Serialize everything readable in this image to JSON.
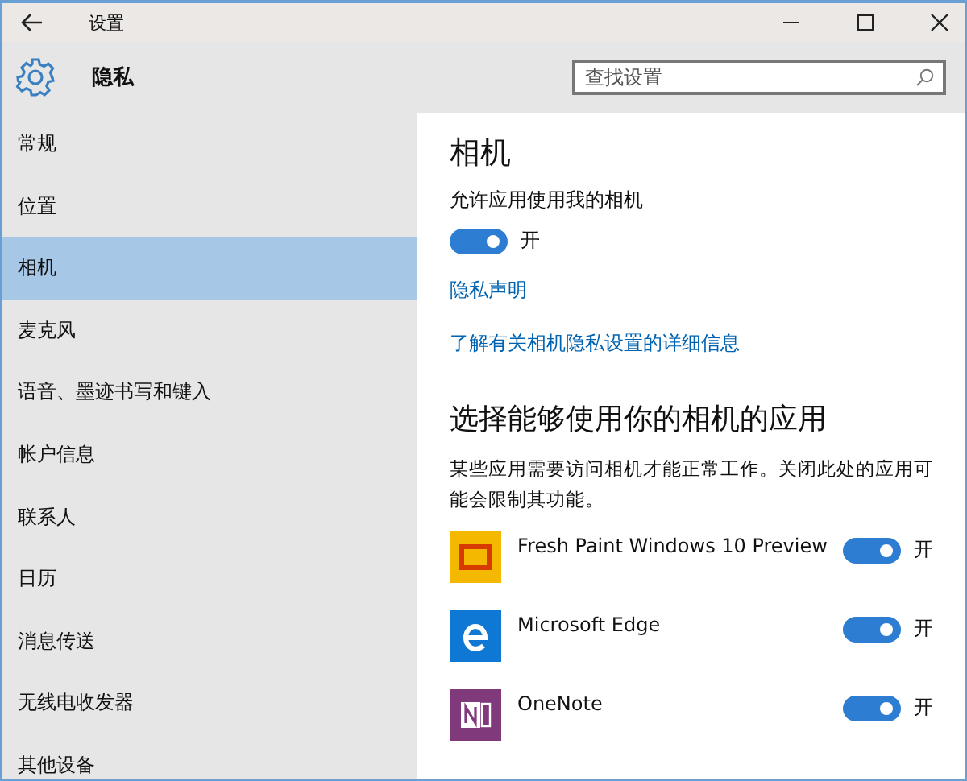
{
  "window": {
    "title": "设置"
  },
  "header": {
    "title": "隐私",
    "search": {
      "placeholder": "查找设置"
    }
  },
  "sidebar": {
    "items": [
      {
        "label": "常规",
        "selected": false
      },
      {
        "label": "位置",
        "selected": false
      },
      {
        "label": "相机",
        "selected": true
      },
      {
        "label": "麦克风",
        "selected": false
      },
      {
        "label": "语音、墨迹书写和键入",
        "selected": false
      },
      {
        "label": "帐户信息",
        "selected": false
      },
      {
        "label": "联系人",
        "selected": false
      },
      {
        "label": "日历",
        "selected": false
      },
      {
        "label": "消息传送",
        "selected": false
      },
      {
        "label": "无线电收发器",
        "selected": false
      },
      {
        "label": "其他设备",
        "selected": false
      }
    ]
  },
  "content": {
    "title": "相机",
    "main_toggle": {
      "label": "允许应用使用我的相机",
      "on": true,
      "state": "开"
    },
    "links": [
      "隐私声明",
      "了解有关相机隐私设置的详细信息"
    ],
    "apps_heading": "选择能够使用你的相机的应用",
    "apps_description": "某些应用需要访问相机才能正常工作。关闭此处的应用可能会限制其功能。",
    "apps": [
      {
        "kind": "paint",
        "name": "Fresh Paint Windows 10 Preview",
        "on": true,
        "state": "开"
      },
      {
        "kind": "edge",
        "name": "Microsoft Edge",
        "on": true,
        "state": "开"
      },
      {
        "kind": "onenote",
        "name": "OneNote",
        "on": true,
        "state": "开"
      }
    ]
  }
}
